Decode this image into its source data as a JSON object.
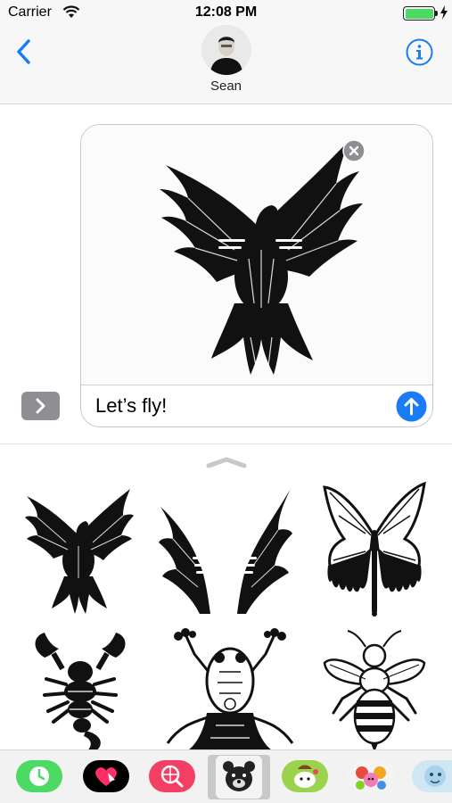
{
  "status_bar": {
    "carrier": "Carrier",
    "time": "12:08 PM",
    "battery_level": 1.0,
    "battery_color": "#4cd964",
    "icons": [
      "wifi-icon",
      "battery-icon",
      "charging-bolt-icon"
    ]
  },
  "header": {
    "contact_name": "Sean",
    "back_icon": "chevron-left-icon",
    "info_icon": "info-icon",
    "accent_color": "#1a7cf5"
  },
  "compose": {
    "message_text": "Let’s fly!",
    "attached_sticker": "eagle-sticker",
    "remove_icon": "close-circle-icon",
    "send_icon": "send-arrow-icon",
    "expand_icon": "chevron-right-icon"
  },
  "sticker_drawer": {
    "grabber_icon": "grabber-chevron-icon",
    "stickers": [
      "eagle-sticker",
      "wings-sticker",
      "butterfly-sticker",
      "scorpion-sticker",
      "frog-sticker",
      "bee-sticker"
    ]
  },
  "app_strip": {
    "apps": [
      {
        "name": "recents-app",
        "color": "#4cd964"
      },
      {
        "name": "digital-touch-app",
        "color": "#000000"
      },
      {
        "name": "images-search-app",
        "color": "#f23f63"
      },
      {
        "name": "animal-stickers-app",
        "color": "#c9c9cc",
        "selected": true
      },
      {
        "name": "sticker-app-green",
        "color": "#9bd34f"
      },
      {
        "name": "sticker-app-characters",
        "color": "#f0f0f0"
      },
      {
        "name": "sticker-app-blue",
        "color": "#cfe6f3"
      }
    ]
  }
}
